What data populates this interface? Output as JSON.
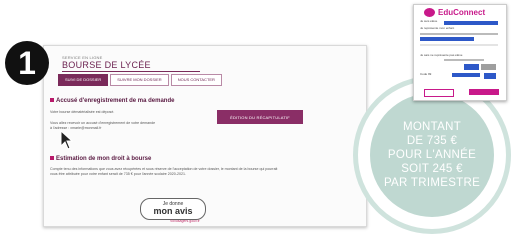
{
  "step": {
    "number": "1"
  },
  "page": {
    "eyebrow": "SERVICE EN LIGNE",
    "title": "BOURSE DE LYCÉE",
    "tabs": [
      {
        "label": "SUIVI DE DOSSIER"
      },
      {
        "label": "SUIVRE MON DOSSIER"
      },
      {
        "label": "NOUS CONTACTER"
      }
    ],
    "section1": {
      "title": "Accusé d'enregistrement de ma demande",
      "line1": "Votre bourse dématérialisée est déposé.",
      "line2": "Vous allez recevoir un accusé d'enregistrement de votre demande",
      "line3": "à l'adresse : xmarie@monmail.fr",
      "button": "ÉDITION DU RÉCAPITULATIF"
    },
    "section2": {
      "title": "Estimation de mon droit à bourse",
      "line1": "Compte tenu des informations que vous avez récupérées et sous réserve de l'acceptation de votre dossier, le montant de la bourse qui pourrait",
      "line2": "vous être attribuée pour votre enfant serait de 735 € pour l'année scolaire 2020-2021."
    },
    "avis": {
      "line1": "Je donne",
      "line2": "mon avis",
      "brand": "Voxusagers.gouv.fr"
    }
  },
  "montant": {
    "lines": [
      "MONTANT",
      "DE 735 €",
      "POUR L'ANNÉE",
      "SOIT 245 €",
      "PAR TRIMESTRE"
    ]
  },
  "educonnect": {
    "brand": "EduConnect",
    "text1": "Je suis élève",
    "text2": "Je représente mon enfant",
    "text3": "Je sais ne représente pas élève",
    "code": "Code 99"
  },
  "colors": {
    "accent": "#7a2a5a",
    "ring": "#cfe3dd",
    "disc": "#bfd8d1",
    "edu": "#c8198a"
  }
}
